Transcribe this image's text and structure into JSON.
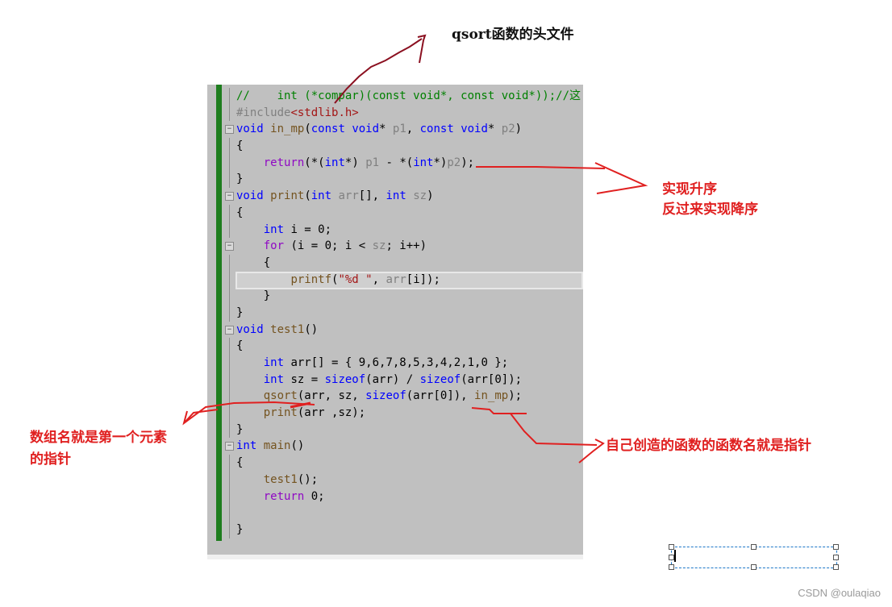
{
  "editor": {
    "lines": [
      {
        "parts": [
          [
            "cm",
            "//    int (*compar)(const void*, const void*));//这"
          ]
        ]
      },
      {
        "parts": [
          [
            "inc",
            "#include"
          ],
          [
            "str",
            "<stdlib.h>"
          ]
        ]
      },
      {
        "fold": true,
        "parts": [
          [
            "kw",
            "void"
          ],
          [
            "",
            " "
          ],
          [
            "fn",
            "in_mp"
          ],
          [
            "",
            "("
          ],
          [
            "kw",
            "const void"
          ],
          [
            "",
            "* "
          ],
          [
            "pr",
            "p1"
          ],
          [
            "",
            ", "
          ],
          [
            "kw",
            "const void"
          ],
          [
            "",
            "* "
          ],
          [
            "pr",
            "p2"
          ],
          [
            "",
            ")"
          ]
        ]
      },
      {
        "parts": [
          [
            "",
            "{"
          ]
        ]
      },
      {
        "parts": [
          [
            "",
            "    "
          ],
          [
            "ctl",
            "return"
          ],
          [
            "",
            "(*("
          ],
          [
            "kw",
            "int"
          ],
          [
            "",
            "*) "
          ],
          [
            "pr",
            "p1"
          ],
          [
            "",
            " - *("
          ],
          [
            "kw",
            "int"
          ],
          [
            "",
            "*)"
          ],
          [
            "pr",
            "p2"
          ],
          [
            "",
            ");"
          ]
        ]
      },
      {
        "parts": [
          [
            "",
            "}"
          ]
        ]
      },
      {
        "fold": true,
        "parts": [
          [
            "kw",
            "void"
          ],
          [
            "",
            " "
          ],
          [
            "fn",
            "print"
          ],
          [
            "",
            "("
          ],
          [
            "kw",
            "int"
          ],
          [
            "",
            " "
          ],
          [
            "pr",
            "arr"
          ],
          [
            "",
            "[], "
          ],
          [
            "kw",
            "int"
          ],
          [
            "",
            " "
          ],
          [
            "pr",
            "sz"
          ],
          [
            "",
            ")"
          ]
        ]
      },
      {
        "parts": [
          [
            "",
            "{"
          ]
        ]
      },
      {
        "parts": [
          [
            "",
            "    "
          ],
          [
            "kw",
            "int"
          ],
          [
            "",
            " i = 0;"
          ]
        ]
      },
      {
        "fold": true,
        "parts": [
          [
            "",
            "    "
          ],
          [
            "ctl",
            "for"
          ],
          [
            "",
            " (i = 0; i < "
          ],
          [
            "pr",
            "sz"
          ],
          [
            "",
            "; i++)"
          ]
        ]
      },
      {
        "parts": [
          [
            "",
            "    {"
          ]
        ]
      },
      {
        "highlight": true,
        "parts": [
          [
            "",
            "        "
          ],
          [
            "fn",
            "printf"
          ],
          [
            "",
            "("
          ],
          [
            "str",
            "\"%d \""
          ],
          [
            "",
            ", "
          ],
          [
            "pr",
            "arr"
          ],
          [
            "",
            "[i]);"
          ]
        ]
      },
      {
        "parts": [
          [
            "",
            "    }"
          ]
        ]
      },
      {
        "parts": [
          [
            "",
            "}"
          ]
        ]
      },
      {
        "fold": true,
        "parts": [
          [
            "kw",
            "void"
          ],
          [
            "",
            " "
          ],
          [
            "fn",
            "test1"
          ],
          [
            "",
            "()"
          ]
        ]
      },
      {
        "parts": [
          [
            "",
            "{"
          ]
        ]
      },
      {
        "parts": [
          [
            "",
            "    "
          ],
          [
            "kw",
            "int"
          ],
          [
            "",
            " arr[] = { 9,6,7,8,5,3,4,2,1,0 };"
          ]
        ]
      },
      {
        "parts": [
          [
            "",
            "    "
          ],
          [
            "kw",
            "int"
          ],
          [
            "",
            " sz = "
          ],
          [
            "kw",
            "sizeof"
          ],
          [
            "",
            "(arr) / "
          ],
          [
            "kw",
            "sizeof"
          ],
          [
            "",
            "(arr[0]);"
          ]
        ]
      },
      {
        "parts": [
          [
            "",
            "    "
          ],
          [
            "fn",
            "qsort"
          ],
          [
            "",
            "(arr, sz, "
          ],
          [
            "kw",
            "sizeof"
          ],
          [
            "",
            "(arr[0]), "
          ],
          [
            "fn",
            "in_mp"
          ],
          [
            "",
            ");"
          ]
        ]
      },
      {
        "parts": [
          [
            "",
            "    "
          ],
          [
            "fn",
            "print"
          ],
          [
            "",
            "(arr ,sz);"
          ]
        ]
      },
      {
        "parts": [
          [
            "",
            "}"
          ]
        ]
      },
      {
        "fold": true,
        "parts": [
          [
            "kw",
            "int"
          ],
          [
            "",
            " "
          ],
          [
            "fn",
            "main"
          ],
          [
            "",
            "()"
          ]
        ]
      },
      {
        "parts": [
          [
            "",
            "{"
          ]
        ]
      },
      {
        "parts": [
          [
            "",
            "    "
          ],
          [
            "fn",
            "test1"
          ],
          [
            "",
            "();"
          ]
        ]
      },
      {
        "parts": [
          [
            "",
            "    "
          ],
          [
            "ctl",
            "return"
          ],
          [
            "",
            " 0;"
          ]
        ]
      },
      {
        "parts": [
          [
            "",
            ""
          ]
        ]
      },
      {
        "parts": [
          [
            "",
            "}"
          ]
        ]
      }
    ]
  },
  "annotations": {
    "header_note": "qsort函数的头文件",
    "ascending_note_1": "实现升序",
    "ascending_note_2": "反过来实现降序",
    "array_note_1": "数组名就是第一个元素",
    "array_note_2": "的指针",
    "function_note": "自己创造的函数的函数名就是指针",
    "colors": {
      "red": "#e02020",
      "dark_red": "#8b1020"
    }
  },
  "watermark": "CSDN @oulaqiao"
}
